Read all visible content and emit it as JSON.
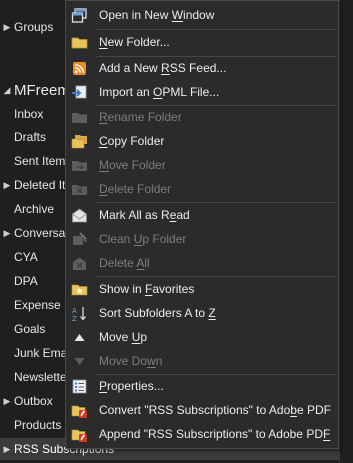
{
  "pane": {
    "groups_label": "Groups",
    "mailbox_label": "MFreem",
    "folders": [
      {
        "label": "Inbox",
        "expand": false
      },
      {
        "label": "Drafts",
        "expand": false
      },
      {
        "label": "Sent Item",
        "expand": false
      },
      {
        "label": "Deleted It",
        "expand": true
      },
      {
        "label": "Archive",
        "expand": false
      },
      {
        "label": "Conversat",
        "expand": true
      },
      {
        "label": "CYA",
        "expand": false
      },
      {
        "label": "DPA",
        "expand": false
      },
      {
        "label": "Expense R",
        "expand": false
      },
      {
        "label": "Goals",
        "expand": false
      },
      {
        "label": "Junk Ema",
        "expand": false
      },
      {
        "label": "Newslette",
        "expand": false
      },
      {
        "label": "Outbox",
        "expand": true
      },
      {
        "label": "Products",
        "expand": false
      },
      {
        "label": "RSS Subscriptions",
        "expand": true
      }
    ]
  },
  "menu": {
    "items": [
      {
        "pre": "Open in New ",
        "ul": "W",
        "post": "indow"
      },
      {
        "pre": "",
        "ul": "N",
        "post": "ew Folder..."
      },
      {
        "pre": "Add a New ",
        "ul": "R",
        "post": "SS Feed..."
      },
      {
        "pre": "Import an ",
        "ul": "O",
        "post": "PML File..."
      },
      {
        "pre": "",
        "ul": "R",
        "post": "ename Folder"
      },
      {
        "pre": "",
        "ul": "C",
        "post": "opy Folder"
      },
      {
        "pre": "",
        "ul": "M",
        "post": "ove Folder"
      },
      {
        "pre": "",
        "ul": "D",
        "post": "elete Folder"
      },
      {
        "pre": "Mark All as R",
        "ul": "e",
        "post": "ad"
      },
      {
        "pre": "Clean ",
        "ul": "U",
        "post": "p Folder"
      },
      {
        "pre": "Delete ",
        "ul": "A",
        "post": "ll"
      },
      {
        "pre": "Show in ",
        "ul": "F",
        "post": "avorites"
      },
      {
        "pre": "Sort Subfolders A to ",
        "ul": "Z",
        "post": ""
      },
      {
        "pre": "Move ",
        "ul": "U",
        "post": "p"
      },
      {
        "pre": "Move Do",
        "ul": "w",
        "post": "n"
      },
      {
        "pre": "",
        "ul": "P",
        "post": "roperties..."
      },
      {
        "pre": "Convert \"RSS Subscriptions\" to Ado",
        "ul": "b",
        "post": "e PDF"
      },
      {
        "pre": "Append \"RSS Subscriptions\" to Adobe PD",
        "ul": "F",
        "post": ""
      }
    ]
  },
  "icons": {
    "open_window": "window-icon",
    "new_folder": "folder-icon",
    "rss": "rss-icon",
    "import": "import-icon",
    "rename": "folder-icon",
    "copy": "folder-copy-icon",
    "move": "folder-move-icon",
    "delete_folder": "folder-delete-icon",
    "mark_read": "envelope-open-icon",
    "clean_up": "clean-up-icon",
    "delete_all": "delete-all-icon",
    "favorites": "star-folder-icon",
    "sort": "sort-icon",
    "move_up": "triangle-up-icon",
    "move_down": "triangle-down-icon",
    "properties": "properties-icon",
    "convert_pdf": "pdf-icon",
    "append_pdf": "pdf-icon"
  },
  "colors": {
    "menu_bg": "#2b2b2b",
    "folder_yellow": "#e8c25a",
    "rss_orange": "#f08a24",
    "pdf_red": "#d23b2b"
  }
}
